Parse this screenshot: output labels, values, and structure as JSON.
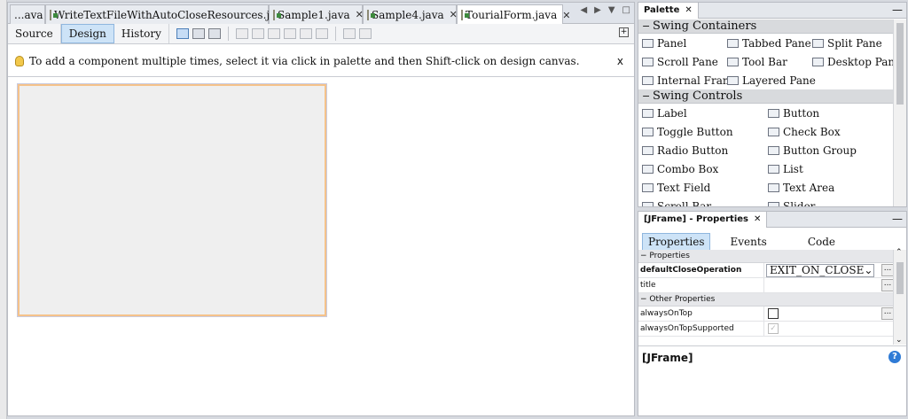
{
  "editor": {
    "tabs": [
      {
        "label": "...ava",
        "closable": true,
        "active": false
      },
      {
        "label": "WriteTextFileWithAutoCloseResources.java",
        "closable": true,
        "active": false
      },
      {
        "label": "Sample1.java",
        "closable": true,
        "active": false
      },
      {
        "label": "Sample4.java",
        "closable": true,
        "active": false
      },
      {
        "label": "TourialForm.java",
        "closable": true,
        "active": true
      }
    ],
    "toolbar": {
      "source_label": "Source",
      "design_label": "Design",
      "history_label": "History"
    },
    "hint": {
      "text": "To add a component multiple times, select it via click in palette and then Shift-click on design canvas.",
      "close": "x"
    }
  },
  "palette": {
    "title": "Palette",
    "sections": [
      {
        "name": "Swing Containers",
        "rows": [
          [
            "Panel",
            "Tabbed Pane",
            "Split Pane"
          ],
          [
            "Scroll Pane",
            "Tool Bar",
            "Desktop Pane"
          ],
          [
            "Internal Frame",
            "Layered Pane"
          ]
        ]
      },
      {
        "name": "Swing Controls",
        "rows": [
          [
            "Label",
            "Button"
          ],
          [
            "Toggle Button",
            "Check Box"
          ],
          [
            "Radio Button",
            "Button Group"
          ],
          [
            "Combo Box",
            "List"
          ],
          [
            "Text Field",
            "Text Area"
          ],
          [
            "Scroll Bar",
            "Slider"
          ]
        ]
      }
    ]
  },
  "properties": {
    "title": "[JFrame] - Properties",
    "tabs": [
      "Properties",
      "Events",
      "Code"
    ],
    "section1": "Properties",
    "section2": "Other Properties",
    "rows": {
      "defaultCloseOperation": {
        "key": "defaultCloseOperation",
        "value": "EXIT_ON_CLOSE"
      },
      "title": {
        "key": "title",
        "value": ""
      },
      "alwaysOnTop": {
        "key": "alwaysOnTop",
        "checked": false
      },
      "alwaysOnTopSupported": {
        "key": "alwaysOnTopSupported",
        "checked": true
      }
    },
    "description_title": "[JFrame]"
  },
  "colors": {
    "accent": "#cde3f7",
    "frame_border": "#f5c28a",
    "help": "#2f7bd6"
  }
}
